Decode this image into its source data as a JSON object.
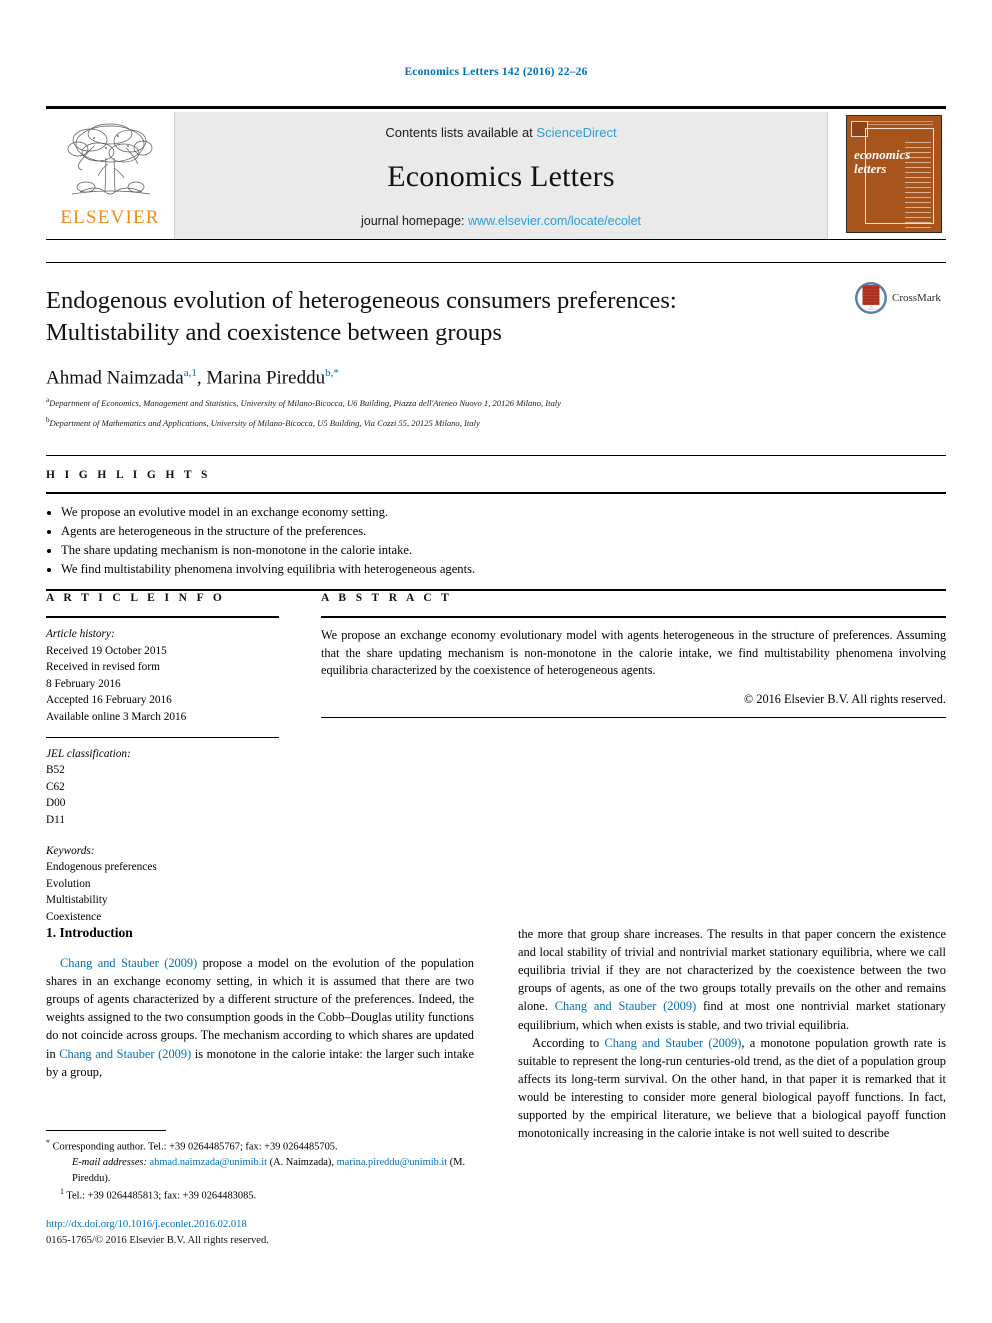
{
  "running_head": "Economics Letters 142 (2016) 22–26",
  "masthead": {
    "publisher_name": "ELSEVIER",
    "contents_prefix": "Contents lists available at ",
    "contents_link": "ScienceDirect",
    "journal_name": "Economics Letters",
    "homepage_prefix": "journal homepage: ",
    "homepage_url": "www.elsevier.com/locate/ecolet",
    "cover_title_line1": "economics",
    "cover_title_line2": "letters"
  },
  "article": {
    "title": "Endogenous evolution of heterogeneous consumers preferences: Multistability and coexistence between groups",
    "authors_html_parts": {
      "author1": "Ahmad Naimzada",
      "author1_sup": "a,1",
      "separator": ", ",
      "author2": "Marina Pireddu",
      "author2_sup": "b,*"
    },
    "affiliation_a_sup": "a",
    "affiliation_a": "Department of Economics, Management and Statistics, University of Milano-Bicocca, U6 Building, Piazza dell'Ateneo Nuovo 1, 20126 Milano, Italy",
    "affiliation_b_sup": "b",
    "affiliation_b": "Department of Mathematics and Applications, University of Milano-Bicocca, U5 Building, Via Cozzi 55, 20125 Milano, Italy",
    "crossmark_label": "CrossMark"
  },
  "highlights": {
    "heading": "H I G H L I G H T S",
    "items": [
      "We propose an evolutive model in an exchange economy setting.",
      "Agents are heterogeneous in the structure of the preferences.",
      "The share updating mechanism is non-monotone in the calorie intake.",
      "We find multistability phenomena involving equilibria with heterogeneous agents."
    ]
  },
  "article_info": {
    "heading": "A R T I C L E   I N F O",
    "history_label": "Article history:",
    "history": [
      "Received 19 October 2015",
      "Received in revised form",
      "8 February 2016",
      "Accepted 16 February 2016",
      "Available online 3 March 2016"
    ],
    "jel_label": "JEL classification:",
    "jel_codes": [
      "B52",
      "C62",
      "D00",
      "D11"
    ],
    "keywords_label": "Keywords:",
    "keywords": [
      "Endogenous preferences",
      "Evolution",
      "Multistability",
      "Coexistence"
    ]
  },
  "abstract": {
    "heading": "A B S T R A C T",
    "text": "We propose an exchange economy evolutionary model with agents heterogeneous in the structure of preferences. Assuming that the share updating mechanism is non-monotone in the calorie intake, we find multistability phenomena involving equilibria characterized by the coexistence of heterogeneous agents.",
    "copyright": "© 2016 Elsevier B.V. All rights reserved."
  },
  "body": {
    "section_title": "1. Introduction",
    "left_paragraph": {
      "ref1": "Chang and Stauber",
      "year1": "(2009)",
      "seg1": " propose a model on the evolution of the population shares in an exchange economy setting, in which it is assumed that there are two groups of agents characterized by a different structure of the preferences. Indeed, the weights assigned to the two consumption goods in the Cobb–Douglas utility functions do not coincide across groups. The mechanism according to which shares are updated in ",
      "ref2": "Chang and Stauber",
      "year2": "(2009)",
      "seg2": " is monotone in the calorie intake: the larger such intake by a group,"
    },
    "right_paragraph_1": {
      "seg1": "the more that group share increases. The results in that paper concern the existence and local stability of trivial and nontrivial market stationary equilibria, where we call equilibria trivial if they are not characterized by the coexistence between the two groups of agents, as one of the two groups totally prevails on the other and remains alone. ",
      "ref1": "Chang and Stauber",
      "year1": "(2009)",
      "seg2": " find at most one nontrivial market stationary equilibrium, which when exists is stable, and two trivial equilibria."
    },
    "right_paragraph_2": {
      "seg1": "According to ",
      "ref1": "Chang and Stauber",
      "year1": "(2009)",
      "seg2": ", a monotone population growth rate is suitable to represent the long-run centuries-old trend, as the diet of a population group affects its long-term survival. On the other hand, in that paper it is remarked that it would be interesting to consider more general biological payoff functions. In fact, supported by the empirical literature, we believe that a biological payoff function monotonically increasing in the calorie intake is not well suited to describe"
    }
  },
  "footnotes": {
    "corresponding_marker": "*",
    "corresponding_text": "Corresponding author. Tel.: +39 0264485767; fax: +39 0264485705.",
    "email_label": "E-mail addresses:",
    "email1": "ahmad.naimzada@unimib.it",
    "email1_name": " (A. Naimzada),",
    "email2": "marina.pireddu@unimib.it",
    "email2_name": " (M. Pireddu).",
    "note1_marker": "1",
    "note1_text": "Tel.: +39 0264485813; fax: +39 0264483085.",
    "doi": "http://dx.doi.org/10.1016/j.econlet.2016.02.018",
    "issn": "0165-1765/© 2016 Elsevier B.V. All rights reserved."
  },
  "colors": {
    "link_blue": "#0170b8",
    "sciencedirect_blue": "#2e9bd6",
    "elsevier_orange": "#f08a1b",
    "cover_brown": "#a8541d"
  }
}
